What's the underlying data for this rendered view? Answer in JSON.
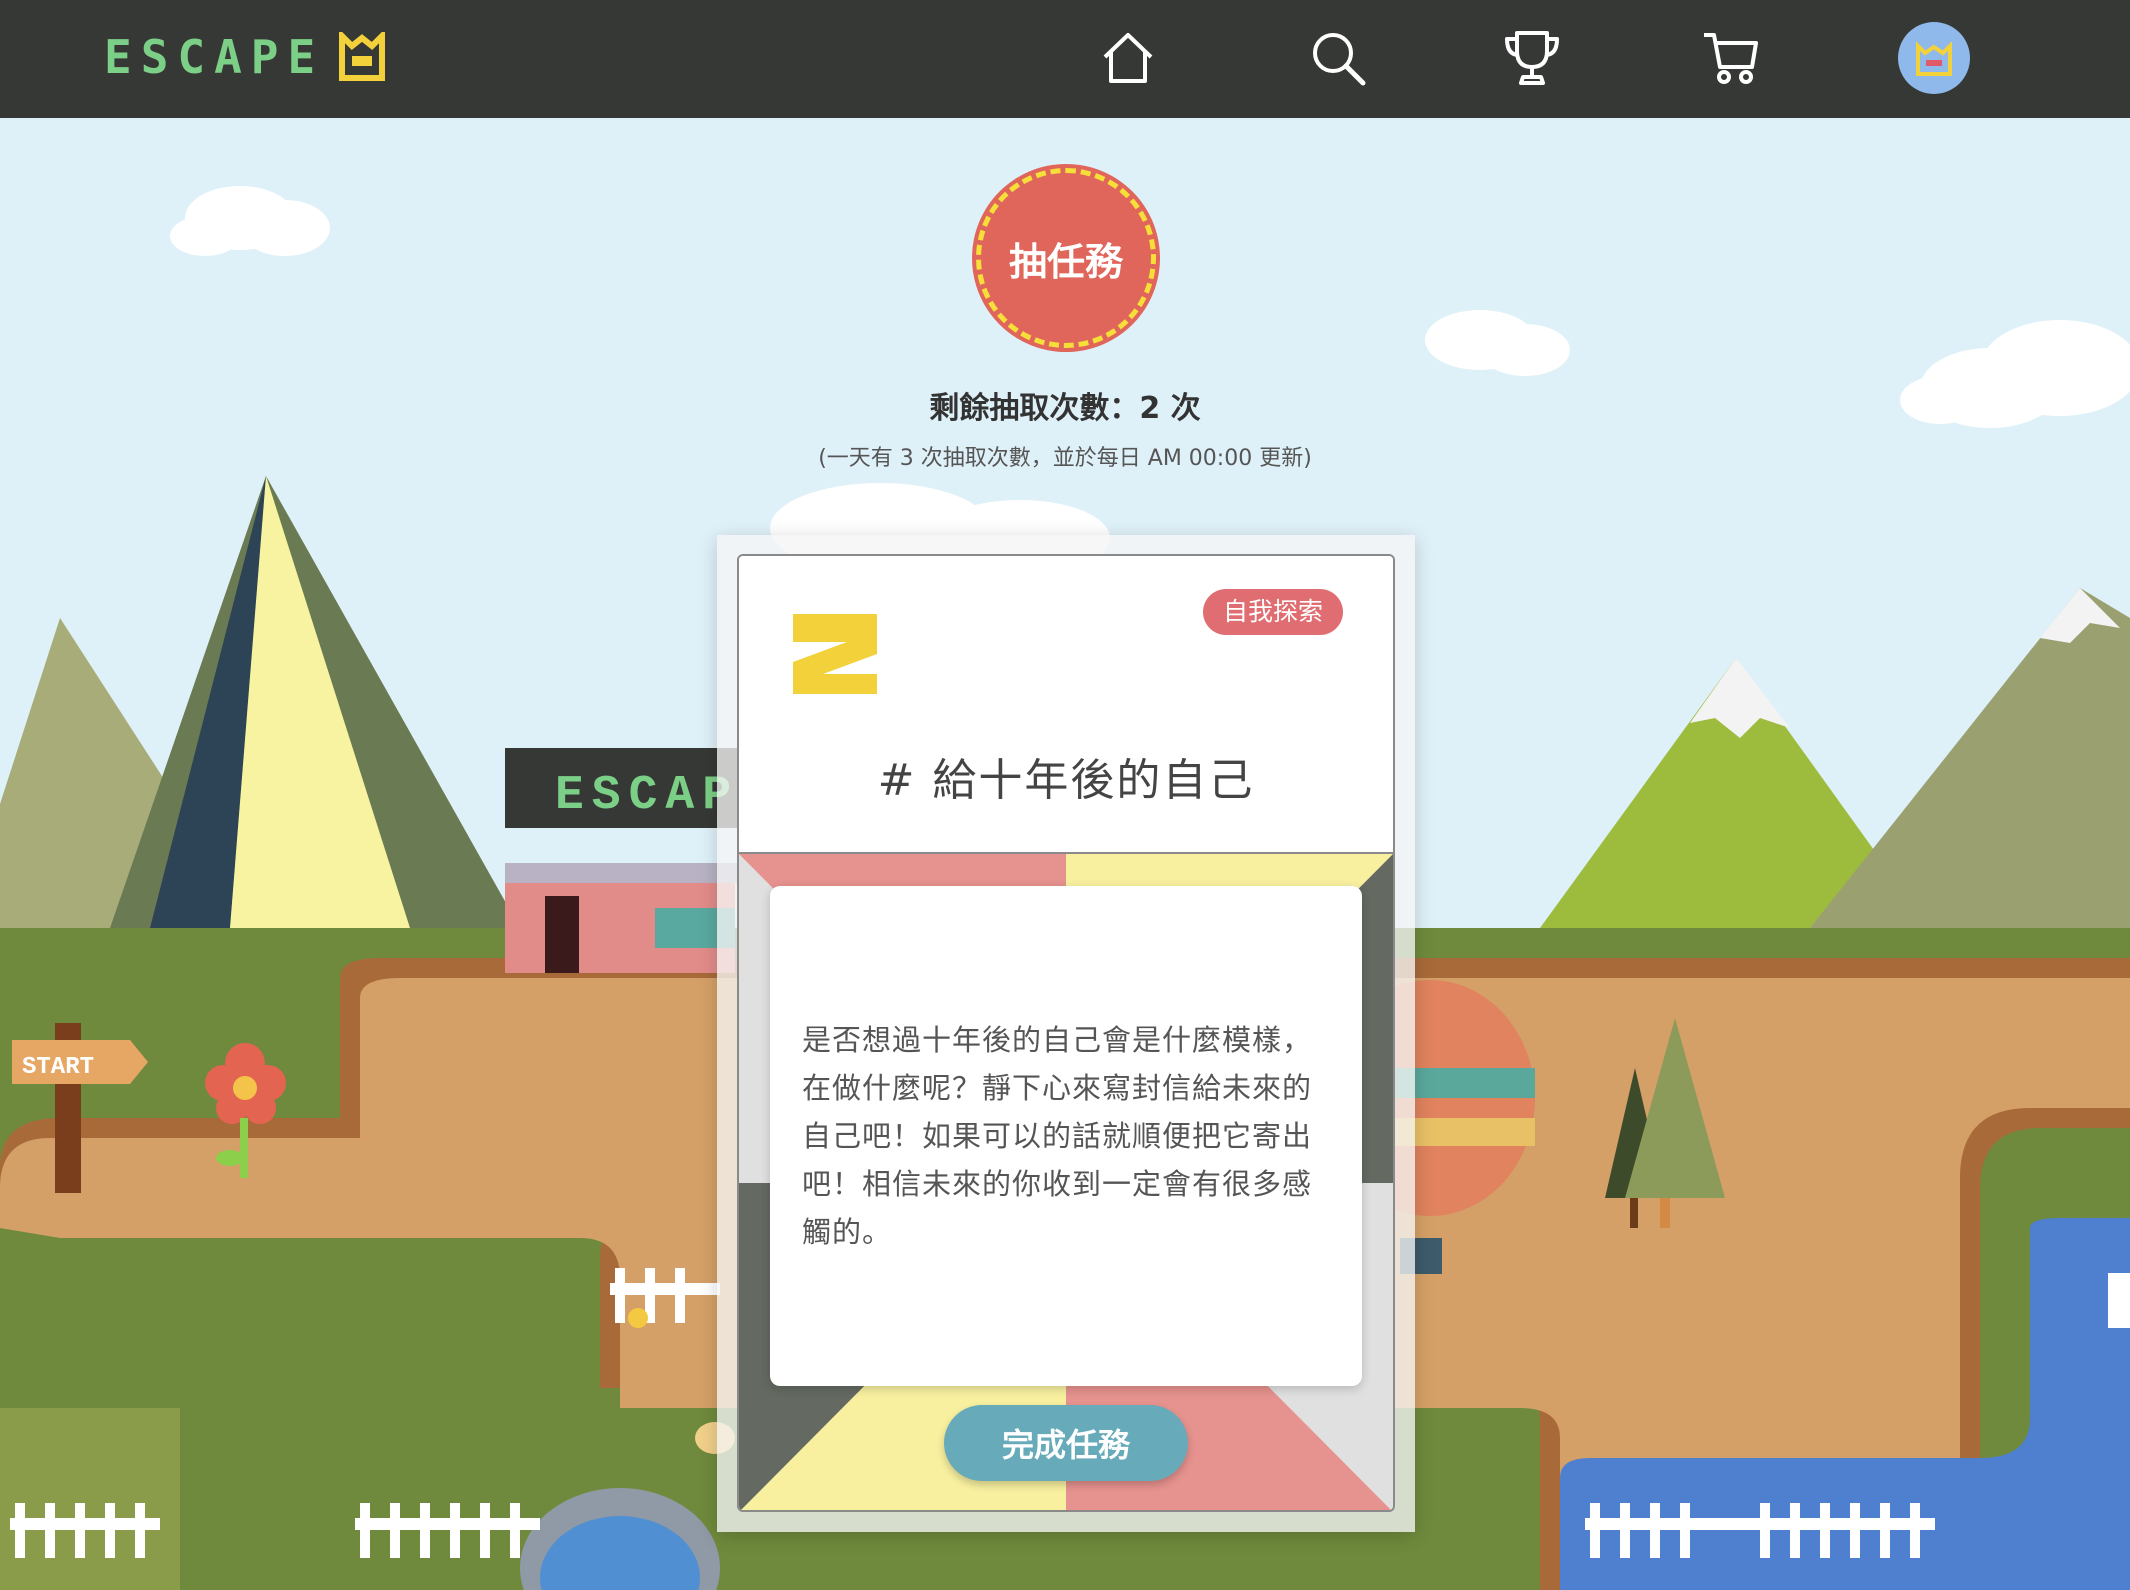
{
  "nav": {
    "brand": "ESCAPE",
    "icons": [
      "home-icon",
      "search-icon",
      "trophy-icon",
      "cart-icon",
      "avatar"
    ]
  },
  "scene": {
    "sign_label": "START",
    "building_sign": "ESCAPE"
  },
  "draw": {
    "button_label": "抽任務",
    "remaining_label": "剩餘抽取次數：2 次",
    "note": "(一天有 3 次抽取次數，並於每日 AM 00:00 更新)"
  },
  "card": {
    "number": "2",
    "tag": "自我探索",
    "title": "# 給十年後的自己",
    "body": "是否想過十年後的自己會是什麼模樣，在做什麼呢？靜下心來寫封信給未來的自己吧！如果可以的話就順便把它寄出吧！相信未來的你收到一定會有很多感觸的。",
    "complete_button": "完成任務"
  },
  "colors": {
    "nav_bg": "#363835",
    "brand": "#7ccf86",
    "draw_button": "#e0665b",
    "tag": "#df6d72",
    "complete_button": "#67abbb"
  }
}
